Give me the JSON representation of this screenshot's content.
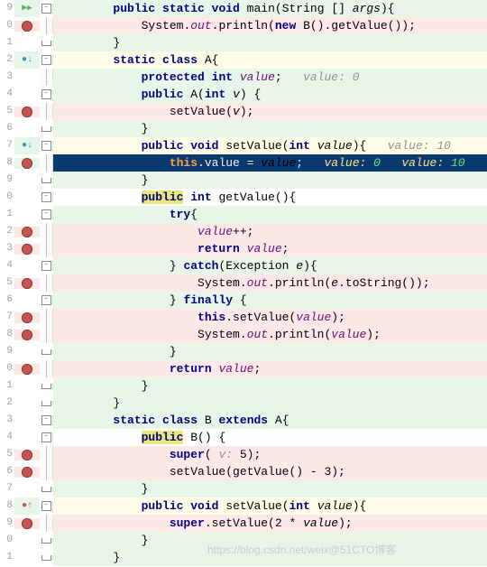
{
  "lines": {
    "l9": {
      "num": "9",
      "bg": "green",
      "mark": "run",
      "fold": "minus",
      "indent": "        ",
      "html": "<span class='kw'>public static void</span> <span class='fn'>main</span>(<span class='cls'>String</span> [] <span class='param'>args</span>){"
    },
    "l10": {
      "num": "0",
      "bg": "pink",
      "mark": "bp",
      "fold": "line",
      "indent": "            ",
      "html": "<span class='cls'>System</span>.<span class='fld'>out</span>.println(<span class='kw'>new</span> B().getValue());"
    },
    "l11": {
      "num": "1",
      "bg": "green",
      "mark": "",
      "fold": "cap",
      "indent": "        ",
      "html": "}"
    },
    "l12": {
      "num": "2",
      "bg": "yellow",
      "mark": "arrdn",
      "fold": "minus",
      "indent": "        ",
      "html": "<span class='kw'>static class</span> <span class='cls'>A</span>{"
    },
    "l13": {
      "num": "3",
      "bg": "green",
      "mark": "",
      "fold": "line",
      "indent": "            ",
      "html": "<span class='kw'>protected int</span> <span class='fld'>value</span>;   <span class='hint'>value: 0</span>"
    },
    "l14": {
      "num": "4",
      "bg": "green",
      "mark": "",
      "fold": "minus",
      "indent": "            ",
      "html": "<span class='kw'>public</span> A(<span class='kw'>int</span> <span class='param'>v</span>) {"
    },
    "l15": {
      "num": "5",
      "bg": "pink",
      "mark": "bp",
      "fold": "line",
      "indent": "                ",
      "html": "setValue(<span class='param'>v</span>);"
    },
    "l16": {
      "num": "6",
      "bg": "green",
      "mark": "",
      "fold": "cap",
      "indent": "            ",
      "html": "}"
    },
    "l17": {
      "num": "7",
      "bg": "yellow",
      "mark": "arrdn",
      "fold": "minus",
      "indent": "            ",
      "html": "<span class='kw'>public void</span> <span class='fn'>setValue</span>(<span class='kw'>int</span> <span class='param'>value</span>){   <span class='hint'>value: 10</span>"
    },
    "l18": {
      "num": "8",
      "bg": "sel",
      "mark": "bp",
      "fold": "line",
      "indent": "                ",
      "html": "<span class='kw'>this</span>.value = <span class='param'>value</span>;   <span class='hint'>value: </span><span class='hintv'>0</span>   <span class='hint'>value: </span><span class='hintv'>10</span>"
    },
    "l19": {
      "num": "9",
      "bg": "green",
      "mark": "",
      "fold": "cap",
      "indent": "            ",
      "html": "}"
    },
    "l20": {
      "num": "0",
      "bg": "white",
      "mark": "",
      "fold": "minus",
      "indent": "            ",
      "html": "<span class='hl-y'><span class='kw'>public</span></span> <span class='kw'>int</span> <span class='fn'>getValue</span>(){"
    },
    "l21": {
      "num": "1",
      "bg": "green",
      "mark": "",
      "fold": "minus",
      "indent": "                ",
      "html": "<span class='kw'>try</span>{"
    },
    "l22": {
      "num": "2",
      "bg": "pink",
      "mark": "bp",
      "fold": "line",
      "indent": "                    ",
      "html": "<span class='fld'>value</span>++;"
    },
    "l23": {
      "num": "3",
      "bg": "pink",
      "mark": "bp",
      "fold": "line",
      "indent": "                    ",
      "html": "<span class='kw'>return</span> <span class='fld'>value</span>;"
    },
    "l24": {
      "num": "4",
      "bg": "green",
      "mark": "",
      "fold": "minus",
      "indent": "                ",
      "html": "} <span class='kw'>catch</span>(<span class='cls'>Exception</span> <span class='param'>e</span>){"
    },
    "l25": {
      "num": "5",
      "bg": "pink",
      "mark": "bp",
      "fold": "line",
      "indent": "                    ",
      "html": "<span class='cls'>System</span>.<span class='fld'>out</span>.println(<span class='param'>e</span>.toString());"
    },
    "l26": {
      "num": "6",
      "bg": "green",
      "mark": "",
      "fold": "minus",
      "indent": "                ",
      "html": "} <span class='kw'>finally</span> {"
    },
    "l27": {
      "num": "7",
      "bg": "pink",
      "mark": "bp",
      "fold": "line",
      "indent": "                    ",
      "html": "<span class='kw'>this</span>.setValue(<span class='fld'>value</span>);"
    },
    "l28": {
      "num": "8",
      "bg": "pink",
      "mark": "bp",
      "fold": "line",
      "indent": "                    ",
      "html": "<span class='cls'>System</span>.<span class='fld'>out</span>.println(<span class='fld'>value</span>);"
    },
    "l29": {
      "num": "9",
      "bg": "green",
      "mark": "",
      "fold": "cap",
      "indent": "                ",
      "html": "}"
    },
    "l30": {
      "num": "0",
      "bg": "pink",
      "mark": "bp",
      "fold": "line",
      "indent": "                ",
      "html": "<span class='kw'>return</span> <span class='fld'>value</span>;"
    },
    "l31": {
      "num": "1",
      "bg": "green",
      "mark": "",
      "fold": "cap",
      "indent": "            ",
      "html": "}"
    },
    "l32": {
      "num": "2",
      "bg": "green",
      "mark": "",
      "fold": "cap",
      "indent": "        ",
      "html": "}"
    },
    "l33": {
      "num": "3",
      "bg": "green",
      "mark": "",
      "fold": "minus",
      "indent": "        ",
      "html": "<span class='kw'>static class</span> <span class='cls'>B</span> <span class='kw'>extends</span> <span class='cls'>A</span>{"
    },
    "l34": {
      "num": "4",
      "bg": "white",
      "mark": "",
      "fold": "minus",
      "indent": "            ",
      "html": "<span class='hl-y'><span class='kw'>public</span></span> B() {"
    },
    "l35": {
      "num": "5",
      "bg": "pink",
      "mark": "bp",
      "fold": "line",
      "indent": "                ",
      "html": "<span class='kw'>super</span>( <span class='hint'>v:</span> 5);"
    },
    "l36": {
      "num": "6",
      "bg": "pink",
      "mark": "bp",
      "fold": "line",
      "indent": "                ",
      "html": "setValue(getValue() - 3);"
    },
    "l37": {
      "num": "7",
      "bg": "green",
      "mark": "",
      "fold": "cap",
      "indent": "            ",
      "html": "}"
    },
    "l38": {
      "num": "8",
      "bg": "yellow",
      "mark": "arrup",
      "fold": "minus",
      "indent": "            ",
      "html": "<span class='kw'>public void</span> <span class='fn'>setValue</span>(<span class='kw'>int</span> <span class='param'>value</span>){"
    },
    "l39": {
      "num": "9",
      "bg": "pink",
      "mark": "bp",
      "fold": "line",
      "indent": "                ",
      "html": "<span class='kw'>super</span>.setValue(2 * <span class='param'>value</span>);"
    },
    "l40": {
      "num": "0",
      "bg": "green",
      "mark": "",
      "fold": "cap",
      "indent": "            ",
      "html": "}"
    },
    "l41": {
      "num": "1",
      "bg": "green",
      "mark": "",
      "fold": "cap",
      "indent": "        ",
      "html": "}"
    }
  },
  "order": [
    "l9",
    "l10",
    "l11",
    "l12",
    "l13",
    "l14",
    "l15",
    "l16",
    "l17",
    "l18",
    "l19",
    "l20",
    "l21",
    "l22",
    "l23",
    "l24",
    "l25",
    "l26",
    "l27",
    "l28",
    "l29",
    "l30",
    "l31",
    "l32",
    "l33",
    "l34",
    "l35",
    "l36",
    "l37",
    "l38",
    "l39",
    "l40",
    "l41"
  ],
  "watermark": "https://blog.csdn.net/weix@51CTO博客"
}
